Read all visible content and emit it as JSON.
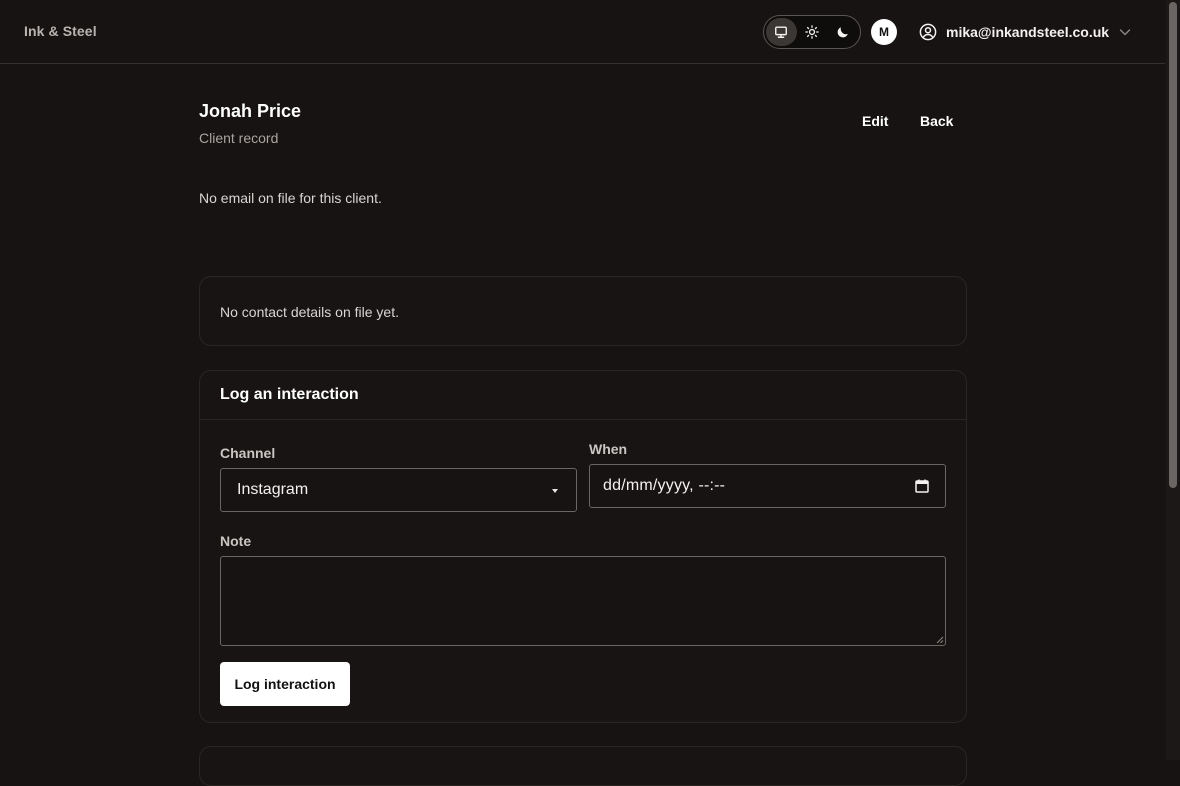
{
  "app": {
    "brand": "Ink & Steel"
  },
  "topbar": {
    "theme_options": [
      "monitor-icon",
      "sun-icon",
      "moon-icon"
    ],
    "active_theme": "system",
    "avatar_initial": "M",
    "user_email": "mika@inkandsteel.co.uk"
  },
  "header": {
    "title": "Jonah Price",
    "subtitle": "Client record",
    "edit_label": "Edit",
    "back_label": "Back"
  },
  "email_notice": "No email on file for this client.",
  "contact_card": {
    "text": "No contact details on file yet."
  },
  "log_form": {
    "title": "Log an interaction",
    "channel_label": "Channel",
    "channel_value": "Instagram",
    "when_label": "When",
    "when_placeholder": "dd/mm/yyyy, --:--",
    "note_label": "Note",
    "note_value": "",
    "submit_label": "Log interaction"
  },
  "colors": {
    "background": "#161312",
    "card_border": "#2a2624",
    "input_border": "#6a6664",
    "primary_button": "#ffffff"
  }
}
